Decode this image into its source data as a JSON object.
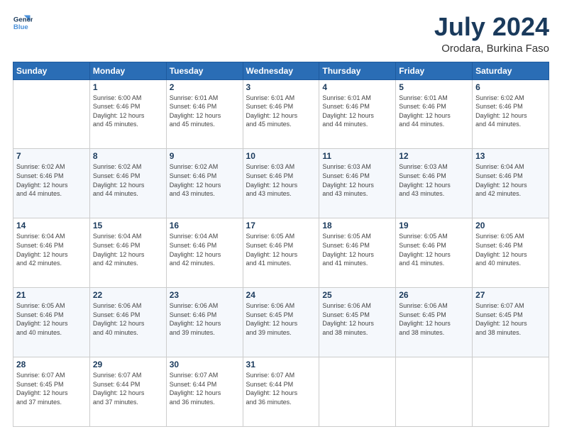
{
  "header": {
    "logo_line1": "General",
    "logo_line2": "Blue",
    "title": "July 2024",
    "subtitle": "Orodara, Burkina Faso"
  },
  "days_of_week": [
    "Sunday",
    "Monday",
    "Tuesday",
    "Wednesday",
    "Thursday",
    "Friday",
    "Saturday"
  ],
  "weeks": [
    [
      {
        "day": "",
        "info": ""
      },
      {
        "day": "1",
        "info": "Sunrise: 6:00 AM\nSunset: 6:46 PM\nDaylight: 12 hours\nand 45 minutes."
      },
      {
        "day": "2",
        "info": "Sunrise: 6:01 AM\nSunset: 6:46 PM\nDaylight: 12 hours\nand 45 minutes."
      },
      {
        "day": "3",
        "info": "Sunrise: 6:01 AM\nSunset: 6:46 PM\nDaylight: 12 hours\nand 45 minutes."
      },
      {
        "day": "4",
        "info": "Sunrise: 6:01 AM\nSunset: 6:46 PM\nDaylight: 12 hours\nand 44 minutes."
      },
      {
        "day": "5",
        "info": "Sunrise: 6:01 AM\nSunset: 6:46 PM\nDaylight: 12 hours\nand 44 minutes."
      },
      {
        "day": "6",
        "info": "Sunrise: 6:02 AM\nSunset: 6:46 PM\nDaylight: 12 hours\nand 44 minutes."
      }
    ],
    [
      {
        "day": "7",
        "info": "Sunrise: 6:02 AM\nSunset: 6:46 PM\nDaylight: 12 hours\nand 44 minutes."
      },
      {
        "day": "8",
        "info": "Sunrise: 6:02 AM\nSunset: 6:46 PM\nDaylight: 12 hours\nand 44 minutes."
      },
      {
        "day": "9",
        "info": "Sunrise: 6:02 AM\nSunset: 6:46 PM\nDaylight: 12 hours\nand 43 minutes."
      },
      {
        "day": "10",
        "info": "Sunrise: 6:03 AM\nSunset: 6:46 PM\nDaylight: 12 hours\nand 43 minutes."
      },
      {
        "day": "11",
        "info": "Sunrise: 6:03 AM\nSunset: 6:46 PM\nDaylight: 12 hours\nand 43 minutes."
      },
      {
        "day": "12",
        "info": "Sunrise: 6:03 AM\nSunset: 6:46 PM\nDaylight: 12 hours\nand 43 minutes."
      },
      {
        "day": "13",
        "info": "Sunrise: 6:04 AM\nSunset: 6:46 PM\nDaylight: 12 hours\nand 42 minutes."
      }
    ],
    [
      {
        "day": "14",
        "info": "Sunrise: 6:04 AM\nSunset: 6:46 PM\nDaylight: 12 hours\nand 42 minutes."
      },
      {
        "day": "15",
        "info": "Sunrise: 6:04 AM\nSunset: 6:46 PM\nDaylight: 12 hours\nand 42 minutes."
      },
      {
        "day": "16",
        "info": "Sunrise: 6:04 AM\nSunset: 6:46 PM\nDaylight: 12 hours\nand 42 minutes."
      },
      {
        "day": "17",
        "info": "Sunrise: 6:05 AM\nSunset: 6:46 PM\nDaylight: 12 hours\nand 41 minutes."
      },
      {
        "day": "18",
        "info": "Sunrise: 6:05 AM\nSunset: 6:46 PM\nDaylight: 12 hours\nand 41 minutes."
      },
      {
        "day": "19",
        "info": "Sunrise: 6:05 AM\nSunset: 6:46 PM\nDaylight: 12 hours\nand 41 minutes."
      },
      {
        "day": "20",
        "info": "Sunrise: 6:05 AM\nSunset: 6:46 PM\nDaylight: 12 hours\nand 40 minutes."
      }
    ],
    [
      {
        "day": "21",
        "info": "Sunrise: 6:05 AM\nSunset: 6:46 PM\nDaylight: 12 hours\nand 40 minutes."
      },
      {
        "day": "22",
        "info": "Sunrise: 6:06 AM\nSunset: 6:46 PM\nDaylight: 12 hours\nand 40 minutes."
      },
      {
        "day": "23",
        "info": "Sunrise: 6:06 AM\nSunset: 6:46 PM\nDaylight: 12 hours\nand 39 minutes."
      },
      {
        "day": "24",
        "info": "Sunrise: 6:06 AM\nSunset: 6:45 PM\nDaylight: 12 hours\nand 39 minutes."
      },
      {
        "day": "25",
        "info": "Sunrise: 6:06 AM\nSunset: 6:45 PM\nDaylight: 12 hours\nand 38 minutes."
      },
      {
        "day": "26",
        "info": "Sunrise: 6:06 AM\nSunset: 6:45 PM\nDaylight: 12 hours\nand 38 minutes."
      },
      {
        "day": "27",
        "info": "Sunrise: 6:07 AM\nSunset: 6:45 PM\nDaylight: 12 hours\nand 38 minutes."
      }
    ],
    [
      {
        "day": "28",
        "info": "Sunrise: 6:07 AM\nSunset: 6:45 PM\nDaylight: 12 hours\nand 37 minutes."
      },
      {
        "day": "29",
        "info": "Sunrise: 6:07 AM\nSunset: 6:44 PM\nDaylight: 12 hours\nand 37 minutes."
      },
      {
        "day": "30",
        "info": "Sunrise: 6:07 AM\nSunset: 6:44 PM\nDaylight: 12 hours\nand 36 minutes."
      },
      {
        "day": "31",
        "info": "Sunrise: 6:07 AM\nSunset: 6:44 PM\nDaylight: 12 hours\nand 36 minutes."
      },
      {
        "day": "",
        "info": ""
      },
      {
        "day": "",
        "info": ""
      },
      {
        "day": "",
        "info": ""
      }
    ]
  ]
}
